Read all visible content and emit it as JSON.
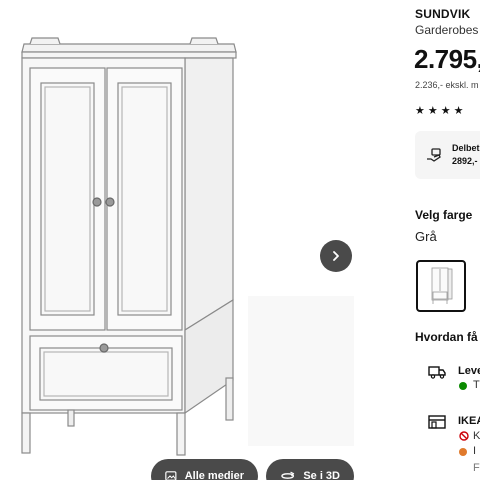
{
  "gallery": {
    "next_icon": "chevron-right-icon",
    "all_media_label": "Alle medier",
    "all_media_icon": "image-gallery-icon",
    "view_3d_label": "Se i 3D",
    "view_3d_icon": "rotate-3d-icon"
  },
  "product": {
    "name": "SUNDVIK",
    "subtitle": "Garderobes",
    "price": "2.795,",
    "price_ex_vat": "2.236,- ekskl. m",
    "rating_stars": "★★★★"
  },
  "payment": {
    "line1": "Delbet",
    "line2": "2892,-"
  },
  "color": {
    "heading": "Velg farge",
    "value": "Grå"
  },
  "delivery": {
    "heading": "Hvordan få p",
    "shipping_label": "Leve",
    "shipping_status": "T",
    "store_label": "IKEA",
    "store_line1": "K",
    "store_line2": "I",
    "store_line3": "F"
  },
  "colors": {
    "button_dark": "#4a4a4a",
    "in_stock": "#0a8a00",
    "limited": "#e07a2c",
    "unavailable": "#cc0008"
  }
}
